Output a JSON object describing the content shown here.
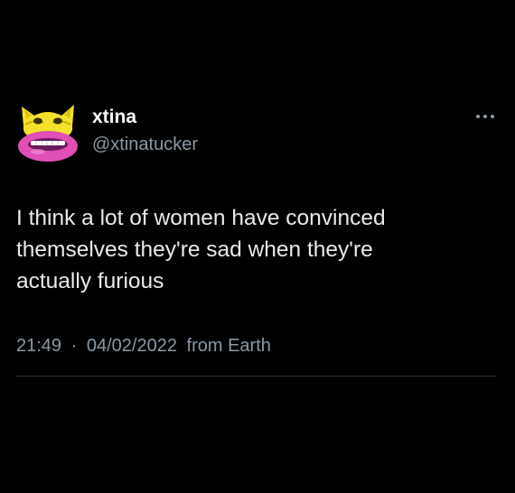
{
  "tweet": {
    "author": {
      "display_name": "xtina",
      "handle": "@xtinatucker"
    },
    "text_lines": [
      "I think a lot of women have convinced",
      "themselves they're sad when they're",
      "actually furious"
    ],
    "time": "21:49",
    "separator": "·",
    "date": "04/02/2022",
    "source": "from Earth"
  },
  "icons": {
    "more": "more-dots-icon",
    "avatar": "avatar-image"
  },
  "colors": {
    "background": "#000000",
    "text_primary": "#e7e9ea",
    "text_secondary": "#8b98a5",
    "divider": "#2f3336",
    "avatar_yellow": "#f3e12b",
    "avatar_pink": "#e04fb3"
  }
}
